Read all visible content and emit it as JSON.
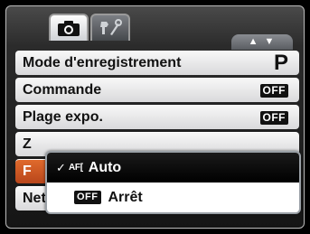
{
  "tabs": [
    {
      "icon": "camera-icon",
      "active": true
    },
    {
      "icon": "wrench-icon",
      "active": false
    }
  ],
  "nav_arrows": "▲ ▼",
  "menu": {
    "rows": [
      {
        "label": "Mode d'enregistrement",
        "value": "P"
      },
      {
        "label": "Commande",
        "value": "OFF"
      },
      {
        "label": "Plage expo.",
        "value": "OFF"
      },
      {
        "label": "Z",
        "value": ""
      },
      {
        "label": "F",
        "value": ""
      },
      {
        "label": "Netteté",
        "value": ""
      }
    ]
  },
  "popup": {
    "options": [
      {
        "check": "✓",
        "icon": "AF[",
        "label": "Auto",
        "selected": true
      },
      {
        "badge": "OFF",
        "label": "Arrêt",
        "selected": false
      }
    ]
  },
  "colors": {
    "selected_row": "#d05a25",
    "row_bg": "#ececed",
    "popup_selected_bg": "#000000",
    "popup_bg": "#ffffff"
  }
}
